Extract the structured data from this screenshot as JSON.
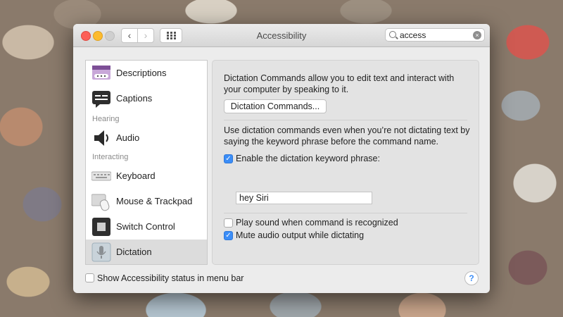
{
  "window": {
    "title": "Accessibility",
    "nav_back": "‹",
    "nav_forward": "›",
    "search": {
      "value": "access",
      "clear": "×"
    }
  },
  "sidebar": {
    "items": [
      {
        "label": "Descriptions",
        "icon": "descriptions-icon"
      },
      {
        "label": "Captions",
        "icon": "captions-icon"
      },
      {
        "section": "Hearing"
      },
      {
        "label": "Audio",
        "icon": "speaker-icon"
      },
      {
        "section": "Interacting"
      },
      {
        "label": "Keyboard",
        "icon": "keyboard-icon"
      },
      {
        "label": "Mouse & Trackpad",
        "icon": "mouse-trackpad-icon"
      },
      {
        "label": "Switch Control",
        "icon": "switch-control-icon"
      },
      {
        "label": "Dictation",
        "icon": "microphone-icon",
        "selected": true
      }
    ]
  },
  "content": {
    "intro": "Dictation Commands allow you to edit text and interact with your computer by speaking to it.",
    "commands_button": "Dictation Commands...",
    "keyword_info": "Use dictation commands even when you’re not dictating text by saying the keyword phrase before the command name.",
    "enable_keyword": {
      "label": "Enable the dictation keyword phrase:",
      "checked": true
    },
    "keyword_phrase": "hey Siri",
    "play_sound": {
      "label": "Play sound when command is recognized",
      "checked": false
    },
    "mute_audio": {
      "label": "Mute audio output while dictating",
      "checked": true
    }
  },
  "footer": {
    "status_menu": {
      "label": "Show Accessibility status in menu bar",
      "checked": false
    },
    "help": "?"
  },
  "colors": {
    "accent": "#3b8df7",
    "selected_row": "#dcdcdc"
  }
}
